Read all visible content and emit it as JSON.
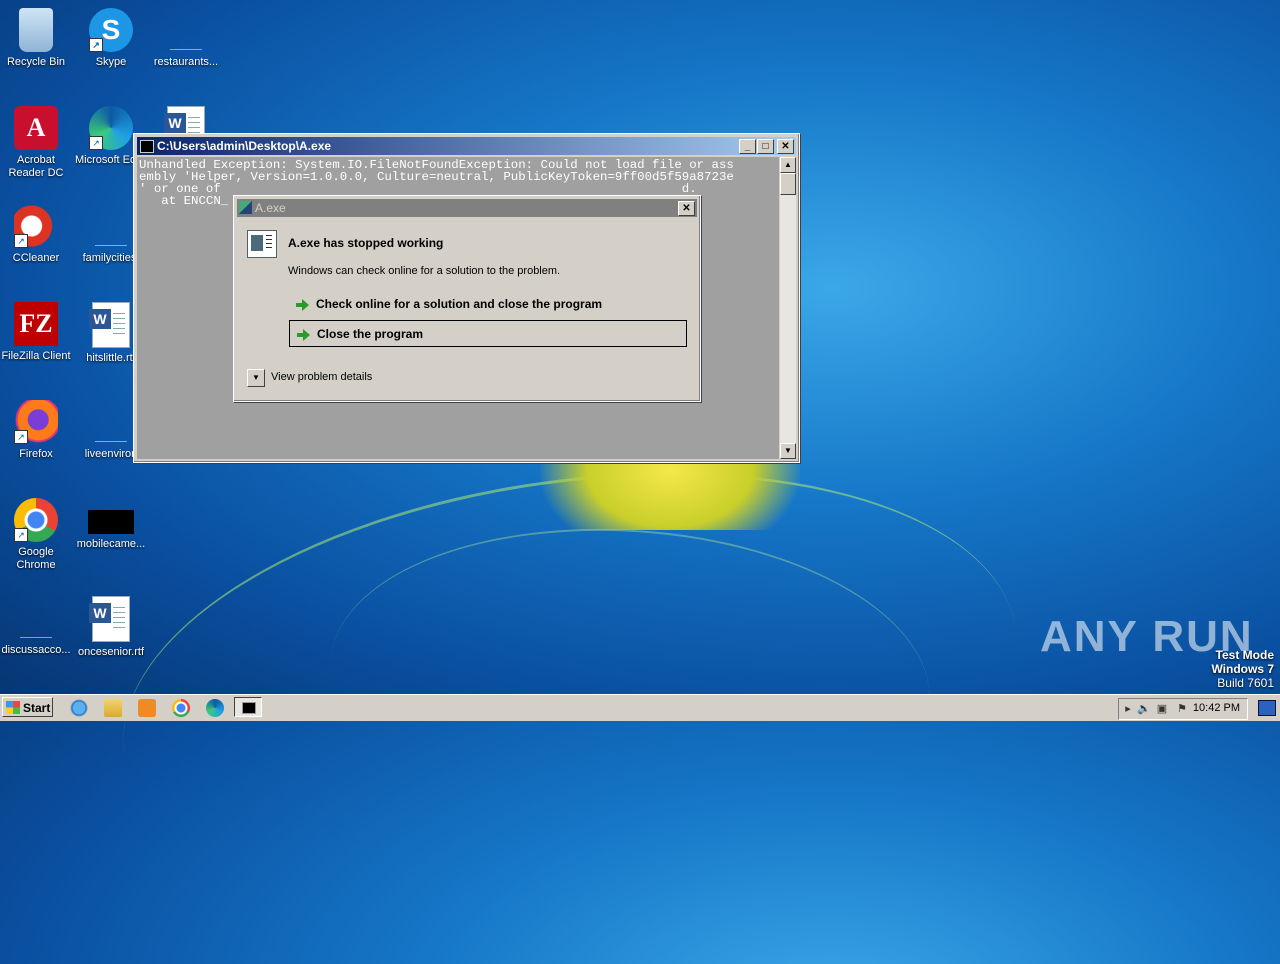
{
  "desktop": {
    "icons": [
      {
        "label": "Recycle Bin",
        "icon": "recycle-bin-icon"
      },
      {
        "label": "Skype",
        "icon": "skype-icon"
      },
      {
        "label": "restaurants...",
        "icon": "file-icon"
      },
      {
        "label": "Acrobat Reader DC",
        "icon": "acrobat-icon"
      },
      {
        "label": "Microsoft Edge",
        "icon": "edge-icon"
      },
      {
        "label": "",
        "icon": "word-document-icon"
      },
      {
        "label": "CCleaner",
        "icon": "ccleaner-icon"
      },
      {
        "label": "familycities.",
        "icon": "file-icon"
      },
      {
        "label": "FileZilla Client",
        "icon": "filezilla-icon"
      },
      {
        "label": "hitslittle.rtf",
        "icon": "word-document-icon"
      },
      {
        "label": "Firefox",
        "icon": "firefox-icon"
      },
      {
        "label": "liveenviron",
        "icon": "file-icon"
      },
      {
        "label": "Google Chrome",
        "icon": "chrome-icon"
      },
      {
        "label": "mobilecame...",
        "icon": "image-file-icon"
      },
      {
        "label": "discussacco...",
        "icon": "file-icon"
      },
      {
        "label": "oncesenior.rtf",
        "icon": "word-document-icon"
      }
    ]
  },
  "console": {
    "title": "C:\\Users\\admin\\Desktop\\A.exe",
    "lines": [
      "Unhandled Exception: System.IO.FileNotFoundException: Could not load file or ass",
      "embly 'Helper, Version=1.0.0.0, Culture=neutral, PublicKeyToken=9ff00d5f59a8723e",
      "' or one of                                                              d.",
      "   at ENCCN_"
    ],
    "buttons": {
      "minimize": "_",
      "maximize": "□",
      "close": "✕"
    }
  },
  "dialog": {
    "title": "A.exe",
    "heading": "A.exe has stopped working",
    "subtext": "Windows can check online for a solution to the problem.",
    "option_check_online": "Check online for a solution and close the program",
    "option_close": "Close the program",
    "details_label": "View problem details",
    "close_glyph": "✕"
  },
  "watermark": {
    "brand": "ANY RUN",
    "mode": "Test Mode",
    "os": "Windows 7",
    "build": "Build 7601"
  },
  "taskbar": {
    "start_label": "Start",
    "clock": "10:42 PM",
    "pinned": [
      "internet-explorer-icon",
      "file-explorer-icon",
      "media-player-icon",
      "chrome-icon",
      "edge-icon",
      "console-window-icon"
    ]
  }
}
